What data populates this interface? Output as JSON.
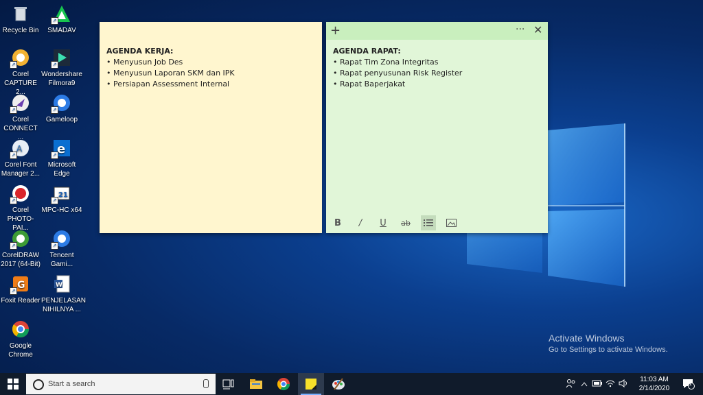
{
  "desktop_icons": [
    {
      "label": "Recycle Bin",
      "icon": "recycle-bin-icon"
    },
    {
      "label": "SMADAV",
      "icon": "smadav-icon"
    },
    {
      "label": "Corel CAPTURE 2...",
      "icon": "corel-capture-icon"
    },
    {
      "label": "Wondershare Filmora9",
      "icon": "filmora-icon"
    },
    {
      "label": "Corel CONNECT ...",
      "icon": "corel-connect-icon"
    },
    {
      "label": "Gameloop",
      "icon": "gameloop-icon"
    },
    {
      "label": "Corel Font Manager 2...",
      "icon": "corel-font-manager-icon"
    },
    {
      "label": "Microsoft Edge",
      "icon": "edge-icon"
    },
    {
      "label": "Corel PHOTO-PAI...",
      "icon": "corel-photo-paint-icon"
    },
    {
      "label": "MPC-HC x64",
      "icon": "mpc-hc-icon"
    },
    {
      "label": "CorelDRAW 2017 (64-Bit)",
      "icon": "coreldraw-icon"
    },
    {
      "label": "Tencent Gami...",
      "icon": "tencent-gaming-icon"
    },
    {
      "label": "Foxit Reader",
      "icon": "foxit-reader-icon"
    },
    {
      "label": "PENJELASAN NIHILNYA ...",
      "icon": "word-document-icon"
    },
    {
      "label": "Google Chrome",
      "icon": "chrome-icon"
    }
  ],
  "notes": {
    "yellow": {
      "title": "AGENDA KERJA:",
      "items": [
        "• Menyusun Job Des",
        "• Menyusun Laporan SKM dan IPK",
        "• Persiapan Assessment Internal"
      ],
      "color": "#fff6cf"
    },
    "green": {
      "title": "AGENDA RAPAT:",
      "items": [
        "• Rapat Tim Zona Integritas",
        "• Rapat penyusunan Risk Register",
        "• Rapat Baperjakat"
      ],
      "color": "#e1f6d8",
      "header": {
        "add": "+",
        "more": "···",
        "close": "✕"
      },
      "toolbar": {
        "bold": "B",
        "italic": "/",
        "underline": "U",
        "strike": "ab"
      }
    }
  },
  "activation": {
    "line1": "Activate Windows",
    "line2": "Go to Settings to activate Windows."
  },
  "taskbar": {
    "search_placeholder": "Start a search",
    "apps": [
      "task-view-icon",
      "file-explorer-icon",
      "chrome-icon",
      "sticky-notes-icon",
      "corel-paint-icon"
    ],
    "time": "11:03 AM",
    "date": "2/14/2020",
    "notification_count": "1"
  }
}
